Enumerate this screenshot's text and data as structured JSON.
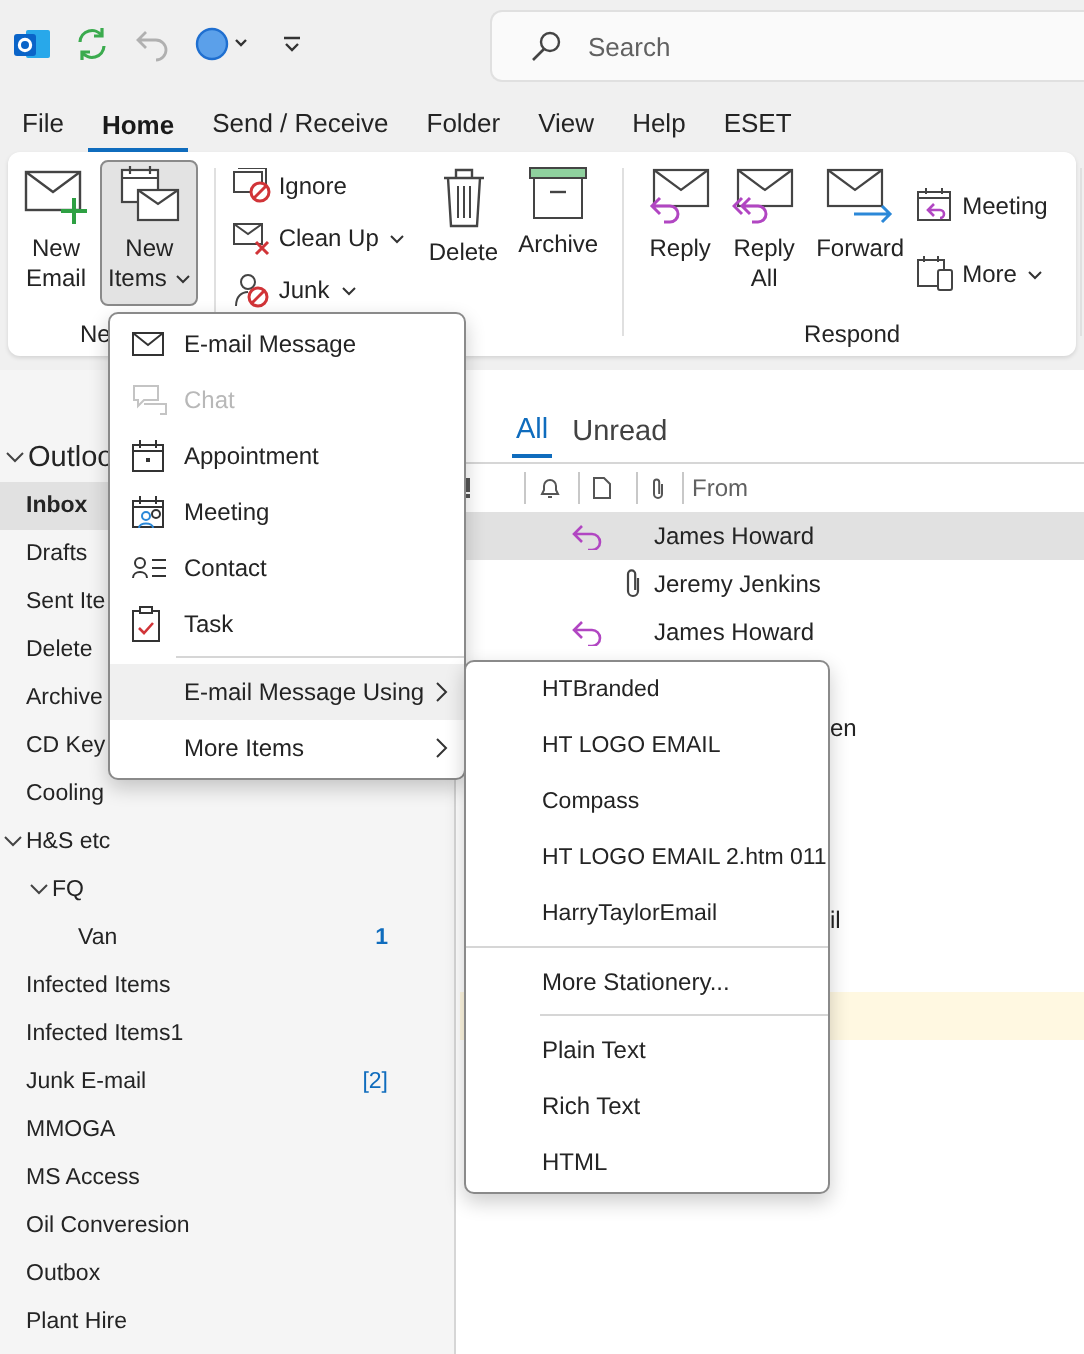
{
  "toolbar": {
    "search": {
      "placeholder": "Search"
    }
  },
  "ribbon_tabs": [
    {
      "label": "File",
      "selected": false
    },
    {
      "label": "Home",
      "selected": true
    },
    {
      "label": "Send / Receive",
      "selected": false
    },
    {
      "label": "Folder",
      "selected": false
    },
    {
      "label": "View",
      "selected": false
    },
    {
      "label": "Help",
      "selected": false
    },
    {
      "label": "ESET",
      "selected": false
    }
  ],
  "ribbon": {
    "new_group": {
      "label": "Ne",
      "new_email": [
        "New",
        "Email"
      ],
      "new_items": {
        "lines": [
          "New",
          "Items"
        ],
        "pressed": true
      }
    },
    "delete_group": {
      "ignore": "Ignore",
      "clean_up": "Clean Up",
      "junk": "Junk",
      "delete": "Delete",
      "archive": "Archive"
    },
    "respond_group": {
      "label": "Respond",
      "reply": [
        "Reply"
      ],
      "reply_all": [
        "Reply",
        "All"
      ],
      "forward": [
        "Forward"
      ],
      "meeting": "Meeting",
      "more": "More"
    }
  },
  "account": {
    "name": "Outloo",
    "expanded": true
  },
  "folders": [
    {
      "name": "Inbox",
      "selected": true
    },
    {
      "name": "Drafts",
      "selected": false
    },
    {
      "name": "Sent Ite",
      "selected": false
    },
    {
      "name": "Delete",
      "selected": false
    },
    {
      "name": "Archive",
      "selected": false
    },
    {
      "name": "CD Key",
      "selected": false
    },
    {
      "name": "Cooling",
      "selected": false
    },
    {
      "name": "H&S etc",
      "selected": false,
      "expanded": true,
      "children": [
        {
          "name": "FQ",
          "selected": false,
          "expanded": true,
          "children": [
            {
              "name": "Van",
              "selected": false,
              "count": "1"
            }
          ]
        }
      ]
    },
    {
      "name": "Infected Items",
      "selected": false
    },
    {
      "name": "Infected Items1",
      "selected": false
    },
    {
      "name": "Junk E-mail",
      "selected": false,
      "count": "[2]"
    },
    {
      "name": "MMOGA",
      "selected": false
    },
    {
      "name": "MS Access",
      "selected": false
    },
    {
      "name": "Oil Converesion",
      "selected": false
    },
    {
      "name": "Outbox",
      "selected": false
    },
    {
      "name": "Plant Hire",
      "selected": false
    }
  ],
  "mail_list": {
    "filters": [
      {
        "label": "All",
        "selected": true
      },
      {
        "label": "Unread",
        "selected": false
      }
    ],
    "columns": [
      "From"
    ],
    "rows": [
      {
        "kind": "reply",
        "from": "James Howard",
        "selected": true,
        "highlighted": false
      },
      {
        "kind": "attachment",
        "from": "Jeremy Jenkins",
        "selected": false,
        "highlighted": false
      },
      {
        "kind": "reply",
        "from": "James Howard",
        "selected": false,
        "highlighted": false
      },
      {
        "kind": "covered",
        "selected": false,
        "highlighted": false
      },
      {
        "kind": "covered",
        "from": "en",
        "selected": false,
        "highlighted": false
      },
      {
        "kind": "covered",
        "selected": false,
        "highlighted": false
      },
      {
        "kind": "covered",
        "selected": false,
        "highlighted": false
      },
      {
        "kind": "covered",
        "selected": false,
        "highlighted": false
      },
      {
        "kind": "covered",
        "from": "il",
        "selected": false,
        "highlighted": false
      },
      {
        "kind": "covered",
        "selected": false,
        "highlighted": false
      },
      {
        "kind": "covered",
        "selected": false,
        "highlighted": true
      }
    ]
  },
  "new_items_menu": [
    {
      "label": "E-mail Message",
      "disabled": false,
      "selected": false
    },
    {
      "label": "Chat",
      "disabled": true,
      "selected": false
    },
    {
      "label": "Appointment",
      "disabled": false,
      "selected": false
    },
    {
      "label": "Meeting",
      "disabled": false,
      "selected": false
    },
    {
      "label": "Contact",
      "disabled": false,
      "selected": false
    },
    {
      "label": "Task",
      "disabled": false,
      "selected": false
    },
    {
      "label": "E-mail Message Using",
      "disabled": false,
      "selected": true,
      "submenu": true
    },
    {
      "label": "More Items",
      "disabled": false,
      "selected": false,
      "submenu": true
    }
  ],
  "stationery_menu": [
    {
      "label": "HTBranded",
      "kind": "stationery"
    },
    {
      "label": "HT LOGO EMAIL",
      "kind": "stationery"
    },
    {
      "label": "Compass",
      "kind": "stationery"
    },
    {
      "label": "HT LOGO EMAIL 2.htm 011",
      "kind": "stationery"
    },
    {
      "label": "HarryTaylorEmail",
      "kind": "stationery"
    },
    {
      "label": "More Stationery...",
      "kind": "more"
    },
    {
      "label": "Plain Text",
      "kind": "format"
    },
    {
      "label": "Rich Text",
      "kind": "format"
    },
    {
      "label": "HTML",
      "kind": "format"
    }
  ]
}
